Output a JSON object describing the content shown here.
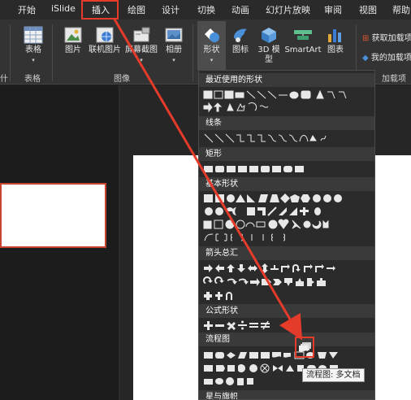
{
  "tabs": [
    "开始",
    "iSlide",
    "插入",
    "绘图",
    "设计",
    "切换",
    "动画",
    "幻灯片放映",
    "审阅",
    "视图",
    "帮助"
  ],
  "active_tab": "插入",
  "ribbon": {
    "table_label": "表格",
    "table_group": "表格",
    "image_btn": "图片",
    "online_image_btn": "联机图片",
    "screenshot_btn": "屏幕截图",
    "album_btn": "相册",
    "image_group": "图像",
    "shapes_btn": "形状",
    "icons_btn": "图标",
    "model3d_btn": "3D 模型",
    "smartart_btn": "SmartArt",
    "chart_btn": "图表",
    "get_addins": "获取加载项",
    "my_addins": "我的加载项",
    "addins_group": "加载项",
    "left_group_tail": "什"
  },
  "dropdown": {
    "sections": [
      "最近使用的形状",
      "线条",
      "矩形",
      "基本形状",
      "箭头总汇",
      "公式形状",
      "流程图",
      "星与旗帜"
    ]
  },
  "tooltip": "流程图: 多文档",
  "colors": {
    "accent_red": "#e53b2b",
    "ribbon_bg": "#333333",
    "dropdown_bg": "#2b2b2b",
    "section_bg": "#3a3a3a"
  }
}
